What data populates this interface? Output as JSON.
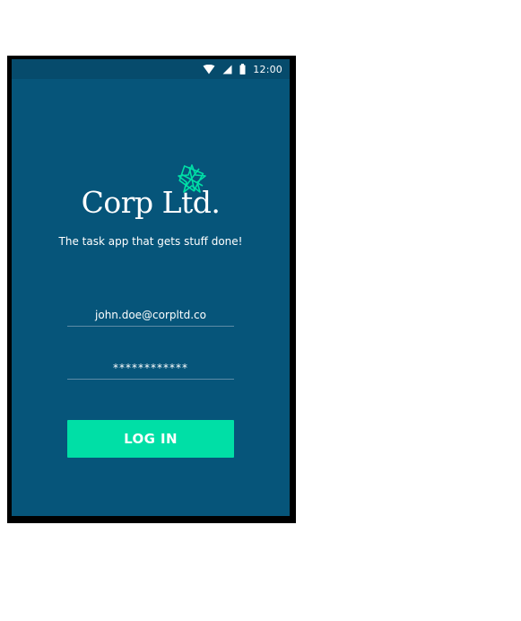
{
  "status_bar": {
    "time": "12:00",
    "icons": [
      "wifi-icon",
      "signal-icon",
      "battery-icon"
    ]
  },
  "app": {
    "logo_text": "Corp Ltd.",
    "tagline": "The task app that gets stuff done!"
  },
  "login_form": {
    "email_value": "john.doe@corpltd.co",
    "password_value": "************",
    "login_button_label": "LOG IN"
  },
  "colors": {
    "background": "#06557a",
    "status_bar": "#064b6c",
    "accent": "#00dfa6",
    "text": "#ffffff"
  }
}
